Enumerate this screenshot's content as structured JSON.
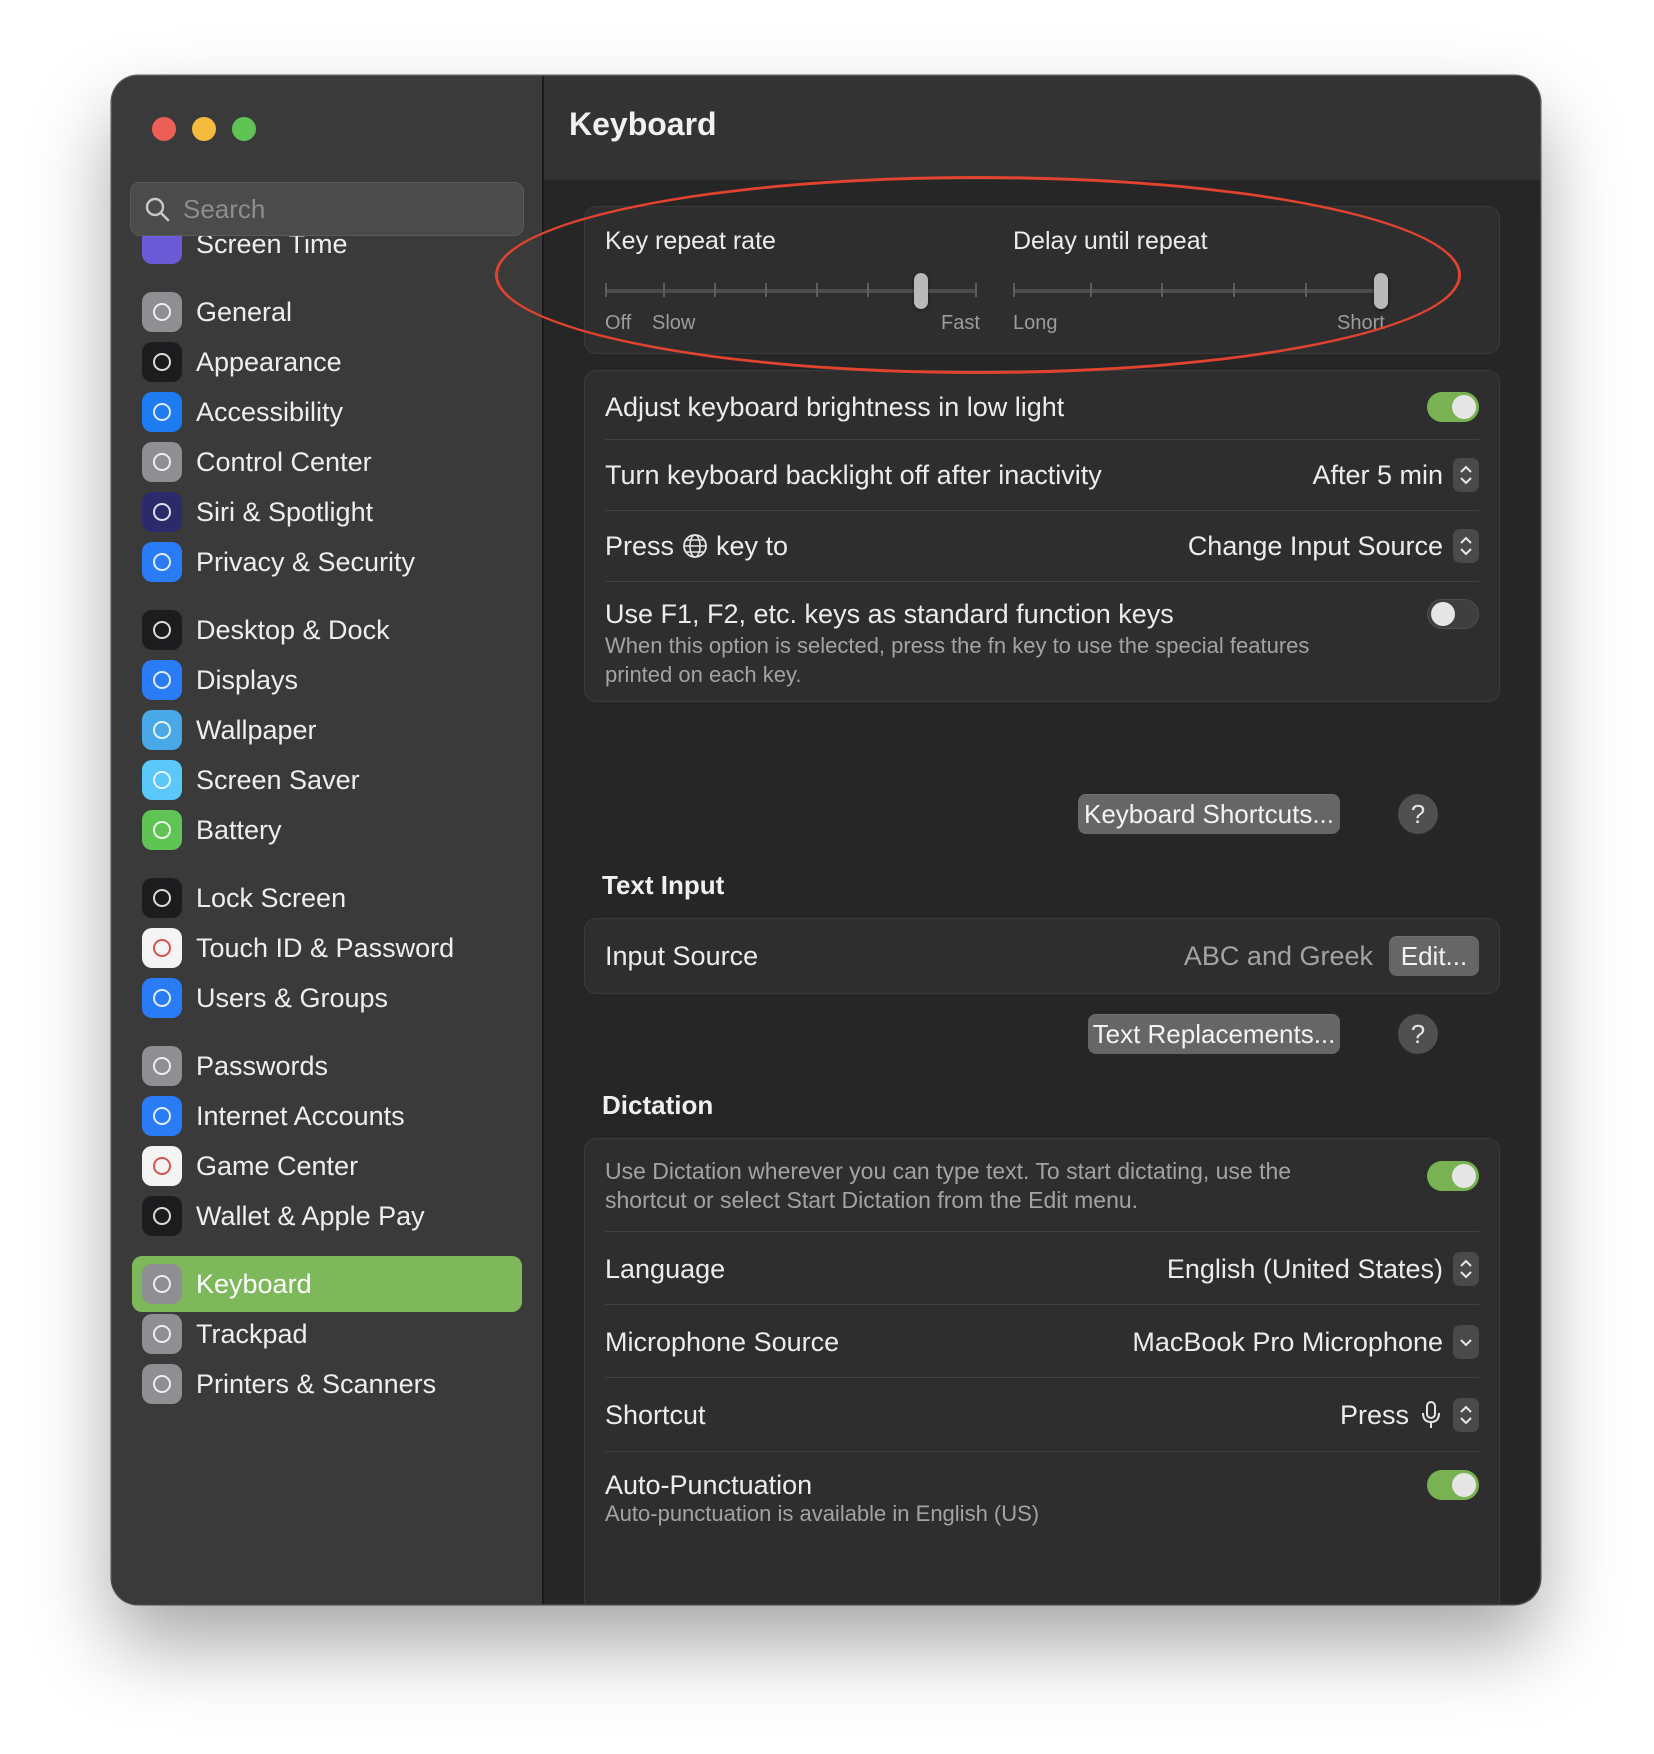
{
  "window": {
    "title": "Keyboard"
  },
  "search": {
    "placeholder": "Search"
  },
  "sidebar": {
    "partial_item": "Screen Time",
    "items": [
      {
        "label": "General",
        "icon": "gear-icon",
        "color": "#8e8e93"
      },
      {
        "label": "Appearance",
        "icon": "appearance-icon",
        "color": "#1c1c1e"
      },
      {
        "label": "Accessibility",
        "icon": "accessibility-icon",
        "color": "#1e7cf2"
      },
      {
        "label": "Control Center",
        "icon": "control-center-icon",
        "color": "#8e8e93"
      },
      {
        "label": "Siri & Spotlight",
        "icon": "siri-icon",
        "color": "#2b2b6b"
      },
      {
        "label": "Privacy & Security",
        "icon": "hand-icon",
        "color": "#2a7cf6"
      },
      {
        "label": "Desktop & Dock",
        "icon": "dock-icon",
        "color": "#1c1c1e"
      },
      {
        "label": "Displays",
        "icon": "sun-icon",
        "color": "#2a7cf6"
      },
      {
        "label": "Wallpaper",
        "icon": "flower-icon",
        "color": "#48a8e8"
      },
      {
        "label": "Screen Saver",
        "icon": "moon-icon",
        "color": "#5ac8fa"
      },
      {
        "label": "Battery",
        "icon": "battery-icon",
        "color": "#5fc453"
      },
      {
        "label": "Lock Screen",
        "icon": "lock-screen-icon",
        "color": "#1c1c1e"
      },
      {
        "label": "Touch ID & Password",
        "icon": "fingerprint-icon",
        "color": "#f4f4f4"
      },
      {
        "label": "Users & Groups",
        "icon": "users-icon",
        "color": "#2a7cf6"
      },
      {
        "label": "Passwords",
        "icon": "key-icon",
        "color": "#8e8e93"
      },
      {
        "label": "Internet Accounts",
        "icon": "at-icon",
        "color": "#2a7cf6"
      },
      {
        "label": "Game Center",
        "icon": "game-center-icon",
        "color": "#f4f4f4"
      },
      {
        "label": "Wallet & Apple Pay",
        "icon": "wallet-icon",
        "color": "#1c1c1e"
      },
      {
        "label": "Keyboard",
        "icon": "keyboard-icon",
        "color": "#8e8e93",
        "active": true
      },
      {
        "label": "Trackpad",
        "icon": "trackpad-icon",
        "color": "#8e8e93"
      },
      {
        "label": "Printers & Scanners",
        "icon": "printer-icon",
        "color": "#8e8e93"
      }
    ]
  },
  "sliders": {
    "key_repeat": {
      "title": "Key repeat rate",
      "off": "Off",
      "slow": "Slow",
      "fast": "Fast",
      "value_fraction": 0.85
    },
    "delay": {
      "title": "Delay until repeat",
      "long": "Long",
      "short": "Short",
      "value_fraction": 1.0
    }
  },
  "keyboard": {
    "brightness_label": "Adjust keyboard brightness in low light",
    "brightness_on": true,
    "backlight_label": "Turn keyboard backlight off after inactivity",
    "backlight_value": "After 5 min",
    "press_label_pre": "Press",
    "press_label_post": "key to",
    "press_value": "Change Input Source",
    "fn_label": "Use F1, F2, etc. keys as standard function keys",
    "fn_desc": "When this option is selected, press the fn key to use the special features printed on each key.",
    "fn_on": false,
    "shortcuts_button": "Keyboard Shortcuts...",
    "help": "?"
  },
  "text_input": {
    "title": "Text Input",
    "input_source_label": "Input Source",
    "input_source_value": "ABC and Greek",
    "edit_button": "Edit...",
    "replacements_button": "Text Replacements...",
    "help": "?"
  },
  "dictation": {
    "title": "Dictation",
    "desc": "Use Dictation wherever you can type text. To start dictating, use the shortcut or select Start Dictation from the Edit menu.",
    "enabled": true,
    "language_label": "Language",
    "language_value": "English (United States)",
    "mic_label": "Microphone Source",
    "mic_value": "MacBook Pro Microphone",
    "shortcut_label": "Shortcut",
    "shortcut_value": "Press",
    "autopunct_label": "Auto-Punctuation",
    "autopunct_desc": "Auto-punctuation is available in English (US)",
    "autopunct_on": true
  },
  "colors": {
    "accent": "#7db85a",
    "toggle_on": "#78b252",
    "annotation": "#e0432f"
  }
}
